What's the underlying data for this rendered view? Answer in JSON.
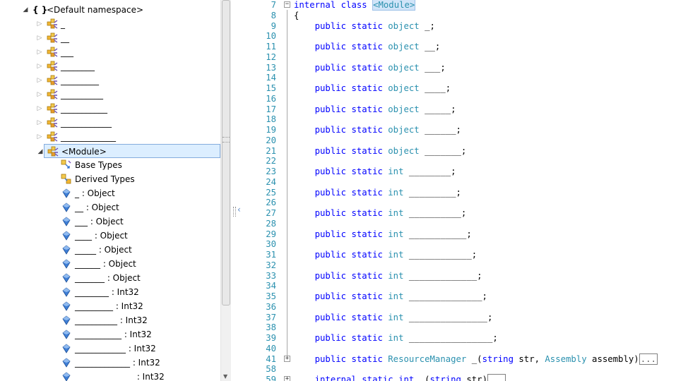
{
  "tree": {
    "namespace": {
      "label": "<Default namespace>",
      "ns_glyph": "{ }",
      "expander": "◢"
    },
    "classes": [
      {
        "label": "_",
        "icon": "class-icon"
      },
      {
        "label": "__",
        "icon": "class-icon"
      },
      {
        "label": "___",
        "icon": "class-icon"
      },
      {
        "label": "________",
        "icon": "class-icon"
      },
      {
        "label": "_________",
        "icon": "class-icon"
      },
      {
        "label": "__________",
        "icon": "class-icon"
      },
      {
        "label": "___________",
        "icon": "class-icon"
      },
      {
        "label": "____________",
        "icon": "class-icon"
      },
      {
        "label": "_____________",
        "icon": "class-icon"
      }
    ],
    "module": {
      "label": "<Module>",
      "icon": "class-icon",
      "expander": "◢"
    },
    "module_children": [
      {
        "label": "Base Types",
        "icon": "base-types-icon"
      },
      {
        "label": "Derived Types",
        "icon": "derived-types-icon"
      },
      {
        "label": "_ : Object",
        "icon": "field-icon"
      },
      {
        "label": "__ : Object",
        "icon": "field-icon"
      },
      {
        "label": "___ : Object",
        "icon": "field-icon"
      },
      {
        "label": "____ : Object",
        "icon": "field-icon"
      },
      {
        "label": "_____ : Object",
        "icon": "field-icon"
      },
      {
        "label": "______ : Object",
        "icon": "field-icon"
      },
      {
        "label": "_______ : Object",
        "icon": "field-icon"
      },
      {
        "label": "________ : Int32",
        "icon": "field-icon"
      },
      {
        "label": "_________ : Int32",
        "icon": "field-icon"
      },
      {
        "label": "__________ : Int32",
        "icon": "field-icon"
      },
      {
        "label": "___________ : Int32",
        "icon": "field-icon"
      },
      {
        "label": "____________ : Int32",
        "icon": "field-icon"
      },
      {
        "label": "_____________ : Int32",
        "icon": "field-icon"
      },
      {
        "label": "______________ : Int32",
        "icon": "field-icon"
      }
    ]
  },
  "splitter": {
    "collapse_glyph": "‹",
    "scroll_down_glyph": "▼"
  },
  "code": {
    "lines": [
      {
        "num": "7",
        "fold": "−",
        "tokens": [
          {
            "t": "internal",
            "c": "kw"
          },
          {
            "t": " "
          },
          {
            "t": "class",
            "c": "kw"
          },
          {
            "t": " "
          },
          {
            "t": "<Module>",
            "c": "ty hl"
          }
        ]
      },
      {
        "num": "8",
        "tokens": [
          {
            "t": "{"
          }
        ]
      },
      {
        "num": "9",
        "tokens": [
          {
            "t": "    "
          },
          {
            "t": "public",
            "c": "kw"
          },
          {
            "t": " "
          },
          {
            "t": "static",
            "c": "kw"
          },
          {
            "t": " "
          },
          {
            "t": "object",
            "c": "ty"
          },
          {
            "t": " _;"
          }
        ]
      },
      {
        "num": "10",
        "tokens": []
      },
      {
        "num": "11",
        "tokens": [
          {
            "t": "    "
          },
          {
            "t": "public",
            "c": "kw"
          },
          {
            "t": " "
          },
          {
            "t": "static",
            "c": "kw"
          },
          {
            "t": " "
          },
          {
            "t": "object",
            "c": "ty"
          },
          {
            "t": " __;"
          }
        ]
      },
      {
        "num": "12",
        "tokens": []
      },
      {
        "num": "13",
        "tokens": [
          {
            "t": "    "
          },
          {
            "t": "public",
            "c": "kw"
          },
          {
            "t": " "
          },
          {
            "t": "static",
            "c": "kw"
          },
          {
            "t": " "
          },
          {
            "t": "object",
            "c": "ty"
          },
          {
            "t": " ___;"
          }
        ]
      },
      {
        "num": "14",
        "tokens": []
      },
      {
        "num": "15",
        "tokens": [
          {
            "t": "    "
          },
          {
            "t": "public",
            "c": "kw"
          },
          {
            "t": " "
          },
          {
            "t": "static",
            "c": "kw"
          },
          {
            "t": " "
          },
          {
            "t": "object",
            "c": "ty"
          },
          {
            "t": " ____;"
          }
        ]
      },
      {
        "num": "16",
        "tokens": []
      },
      {
        "num": "17",
        "tokens": [
          {
            "t": "    "
          },
          {
            "t": "public",
            "c": "kw"
          },
          {
            "t": " "
          },
          {
            "t": "static",
            "c": "kw"
          },
          {
            "t": " "
          },
          {
            "t": "object",
            "c": "ty"
          },
          {
            "t": " _____;"
          }
        ]
      },
      {
        "num": "18",
        "tokens": []
      },
      {
        "num": "19",
        "tokens": [
          {
            "t": "    "
          },
          {
            "t": "public",
            "c": "kw"
          },
          {
            "t": " "
          },
          {
            "t": "static",
            "c": "kw"
          },
          {
            "t": " "
          },
          {
            "t": "object",
            "c": "ty"
          },
          {
            "t": " ______;"
          }
        ]
      },
      {
        "num": "20",
        "tokens": []
      },
      {
        "num": "21",
        "tokens": [
          {
            "t": "    "
          },
          {
            "t": "public",
            "c": "kw"
          },
          {
            "t": " "
          },
          {
            "t": "static",
            "c": "kw"
          },
          {
            "t": " "
          },
          {
            "t": "object",
            "c": "ty"
          },
          {
            "t": " _______;"
          }
        ]
      },
      {
        "num": "22",
        "tokens": []
      },
      {
        "num": "23",
        "tokens": [
          {
            "t": "    "
          },
          {
            "t": "public",
            "c": "kw"
          },
          {
            "t": " "
          },
          {
            "t": "static",
            "c": "kw"
          },
          {
            "t": " "
          },
          {
            "t": "int",
            "c": "ty"
          },
          {
            "t": " ________;"
          }
        ]
      },
      {
        "num": "24",
        "tokens": []
      },
      {
        "num": "25",
        "tokens": [
          {
            "t": "    "
          },
          {
            "t": "public",
            "c": "kw"
          },
          {
            "t": " "
          },
          {
            "t": "static",
            "c": "kw"
          },
          {
            "t": " "
          },
          {
            "t": "int",
            "c": "ty"
          },
          {
            "t": " _________;"
          }
        ]
      },
      {
        "num": "26",
        "tokens": []
      },
      {
        "num": "27",
        "tokens": [
          {
            "t": "    "
          },
          {
            "t": "public",
            "c": "kw"
          },
          {
            "t": " "
          },
          {
            "t": "static",
            "c": "kw"
          },
          {
            "t": " "
          },
          {
            "t": "int",
            "c": "ty"
          },
          {
            "t": " __________;"
          }
        ]
      },
      {
        "num": "28",
        "tokens": []
      },
      {
        "num": "29",
        "tokens": [
          {
            "t": "    "
          },
          {
            "t": "public",
            "c": "kw"
          },
          {
            "t": " "
          },
          {
            "t": "static",
            "c": "kw"
          },
          {
            "t": " "
          },
          {
            "t": "int",
            "c": "ty"
          },
          {
            "t": " ___________;"
          }
        ]
      },
      {
        "num": "30",
        "tokens": []
      },
      {
        "num": "31",
        "tokens": [
          {
            "t": "    "
          },
          {
            "t": "public",
            "c": "kw"
          },
          {
            "t": " "
          },
          {
            "t": "static",
            "c": "kw"
          },
          {
            "t": " "
          },
          {
            "t": "int",
            "c": "ty"
          },
          {
            "t": " ____________;"
          }
        ]
      },
      {
        "num": "32",
        "tokens": []
      },
      {
        "num": "33",
        "tokens": [
          {
            "t": "    "
          },
          {
            "t": "public",
            "c": "kw"
          },
          {
            "t": " "
          },
          {
            "t": "static",
            "c": "kw"
          },
          {
            "t": " "
          },
          {
            "t": "int",
            "c": "ty"
          },
          {
            "t": " _____________;"
          }
        ]
      },
      {
        "num": "34",
        "tokens": []
      },
      {
        "num": "35",
        "tokens": [
          {
            "t": "    "
          },
          {
            "t": "public",
            "c": "kw"
          },
          {
            "t": " "
          },
          {
            "t": "static",
            "c": "kw"
          },
          {
            "t": " "
          },
          {
            "t": "int",
            "c": "ty"
          },
          {
            "t": " ______________;"
          }
        ]
      },
      {
        "num": "36",
        "tokens": []
      },
      {
        "num": "37",
        "tokens": [
          {
            "t": "    "
          },
          {
            "t": "public",
            "c": "kw"
          },
          {
            "t": " "
          },
          {
            "t": "static",
            "c": "kw"
          },
          {
            "t": " "
          },
          {
            "t": "int",
            "c": "ty"
          },
          {
            "t": " _______________;"
          }
        ]
      },
      {
        "num": "38",
        "tokens": []
      },
      {
        "num": "39",
        "tokens": [
          {
            "t": "    "
          },
          {
            "t": "public",
            "c": "kw"
          },
          {
            "t": " "
          },
          {
            "t": "static",
            "c": "kw"
          },
          {
            "t": " "
          },
          {
            "t": "int",
            "c": "ty"
          },
          {
            "t": " ________________;"
          }
        ]
      },
      {
        "num": "40",
        "tokens": []
      },
      {
        "num": "41",
        "fold": "+",
        "tokens": [
          {
            "t": "    "
          },
          {
            "t": "public",
            "c": "kw"
          },
          {
            "t": " "
          },
          {
            "t": "static",
            "c": "kw"
          },
          {
            "t": " "
          },
          {
            "t": "ResourceManager",
            "c": "ty"
          },
          {
            "t": " _("
          },
          {
            "t": "string",
            "c": "kw"
          },
          {
            "t": " str, "
          },
          {
            "t": "Assembly",
            "c": "ty"
          },
          {
            "t": " assembly)"
          },
          {
            "t": "...",
            "c": "collapsed-box"
          }
        ]
      },
      {
        "num": "58",
        "tokens": []
      },
      {
        "num": "59",
        "fold": "+",
        "tokens": [
          {
            "t": "    "
          },
          {
            "t": "internal",
            "c": "kw"
          },
          {
            "t": " "
          },
          {
            "t": "static",
            "c": "kw"
          },
          {
            "t": " "
          },
          {
            "t": "int",
            "c": "kw"
          },
          {
            "t": " _("
          },
          {
            "t": "string",
            "c": "kw"
          },
          {
            "t": " str)"
          },
          {
            "t": "...",
            "c": "collapsed-box"
          }
        ]
      }
    ]
  }
}
